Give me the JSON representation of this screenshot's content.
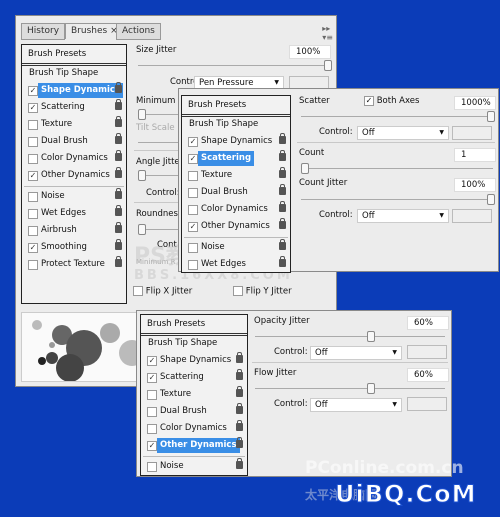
{
  "colors": {
    "background": "#0b3cb8",
    "selection": "#3a8ee6"
  },
  "panel1": {
    "tabs": [
      "History",
      "Brushes",
      "Actions"
    ],
    "tab_close": "×",
    "presets": "Brush Presets",
    "tip": "Brush Tip Shape",
    "items": [
      {
        "label": "Shape Dynamics",
        "checked": true,
        "selected": true
      },
      {
        "label": "Scattering",
        "checked": true
      },
      {
        "label": "Texture",
        "checked": false
      },
      {
        "label": "Dual Brush",
        "checked": false
      },
      {
        "label": "Color Dynamics",
        "checked": false
      },
      {
        "label": "Other Dynamics",
        "checked": true
      },
      {
        "label": "Noise",
        "checked": false,
        "group": true
      },
      {
        "label": "Wet Edges",
        "checked": false
      },
      {
        "label": "Airbrush",
        "checked": false
      },
      {
        "label": "Smoothing",
        "checked": true
      },
      {
        "label": "Protect Texture",
        "checked": false
      }
    ],
    "size_jitter": "Size Jitter",
    "size_jitter_value": "100%",
    "size_jitter_pct": 100,
    "control_label": "Control:",
    "control_value": "Pen Pressure",
    "min_diameter": "Minimum D",
    "tilt_scale": "Tilt Scale",
    "angle_jitter": "Angle Jitter",
    "control_short": "Control:",
    "roundness": "Roundness",
    "control_cut": "Cont",
    "min_roundness": "Minimum R",
    "flip_x": "Flip X Jitter",
    "flip_y": "Flip Y Jitter"
  },
  "panel2": {
    "presets": "Brush Presets",
    "tip": "Brush Tip Shape",
    "items": [
      {
        "label": "Shape Dynamics",
        "checked": true
      },
      {
        "label": "Scattering",
        "checked": true,
        "selected": true
      },
      {
        "label": "Texture",
        "checked": false
      },
      {
        "label": "Dual Brush",
        "checked": false
      },
      {
        "label": "Color Dynamics",
        "checked": false
      },
      {
        "label": "Other Dynamics",
        "checked": true
      },
      {
        "label": "Noise",
        "checked": false,
        "group": true
      },
      {
        "label": "Wet Edges",
        "checked": false
      }
    ],
    "scatter": "Scatter",
    "both_axes": "Both Axes",
    "both_axes_checked": true,
    "scatter_value": "1000%",
    "scatter_pct": 100,
    "control_label": "Control:",
    "control1": "Off",
    "count": "Count",
    "count_value": "1",
    "count_pct": 0,
    "count_jitter": "Count Jitter",
    "count_jitter_value": "100%",
    "count_jitter_pct": 100,
    "control2": "Off"
  },
  "panel3": {
    "presets": "Brush Presets",
    "tip": "Brush Tip Shape",
    "items": [
      {
        "label": "Shape Dynamics",
        "checked": true
      },
      {
        "label": "Scattering",
        "checked": true
      },
      {
        "label": "Texture",
        "checked": false
      },
      {
        "label": "Dual Brush",
        "checked": false
      },
      {
        "label": "Color Dynamics",
        "checked": false
      },
      {
        "label": "Other Dynamics",
        "checked": true,
        "selected": true
      },
      {
        "label": "Noise",
        "checked": false,
        "group": true
      }
    ],
    "opacity_jitter": "Opacity Jitter",
    "opacity_value": "60%",
    "opacity_pct": 60,
    "control_label": "Control:",
    "control1": "Off",
    "flow_jitter": "Flow Jitter",
    "flow_value": "60%",
    "flow_pct": 60,
    "control2": "Off"
  },
  "watermarks": {
    "ps": "PS教程论坛",
    "bbs": "BBS.16XX8.COM",
    "pconline": "PConline.com.cn",
    "uibq": "UiBQ.CoM",
    "cn": "太平洋电脑网"
  }
}
